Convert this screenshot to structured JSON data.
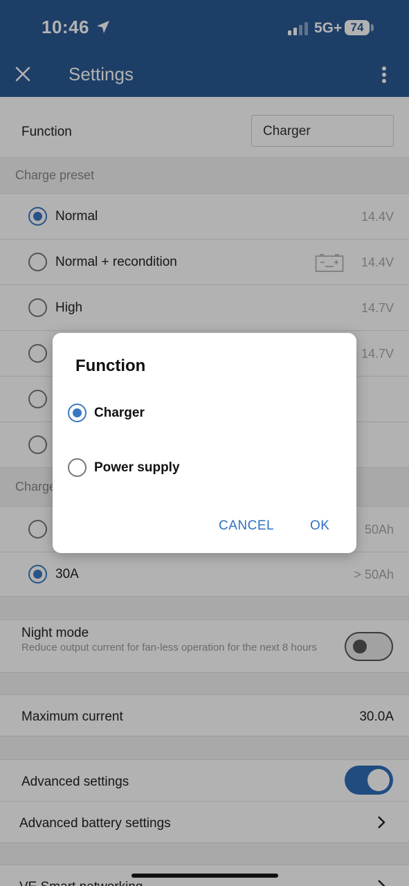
{
  "status_bar": {
    "time": "10:46",
    "network": "5G+",
    "battery": "74"
  },
  "app_bar": {
    "title": "Settings"
  },
  "function_row": {
    "label": "Function",
    "value": "Charger"
  },
  "charge_preset": {
    "heading": "Charge preset",
    "options": [
      {
        "label": "Normal",
        "voltage": "14.4V",
        "selected": true
      },
      {
        "label": "Normal + recondition",
        "voltage": "14.4V",
        "selected": false
      },
      {
        "label": "High",
        "voltage": "14.7V",
        "selected": false
      },
      {
        "label": "",
        "voltage": "14.7V",
        "selected": false
      },
      {
        "label": "",
        "voltage": "",
        "selected": false
      },
      {
        "label": "",
        "voltage": "",
        "selected": false
      }
    ]
  },
  "charge_current": {
    "heading": "Charge",
    "options": [
      {
        "label": "",
        "capacity": "50Ah",
        "selected": false
      },
      {
        "label": "30A",
        "capacity": "> 50Ah",
        "selected": true
      }
    ]
  },
  "night_mode": {
    "label": "Night mode",
    "description": "Reduce output current for fan-less operation for the next 8 hours",
    "enabled": false
  },
  "max_current": {
    "label": "Maximum current",
    "value": "30.0A"
  },
  "advanced_settings": {
    "label": "Advanced settings",
    "enabled": true
  },
  "advanced_battery": {
    "label": "Advanced battery settings"
  },
  "ve_smart": {
    "label": "VE.Smart networking"
  },
  "dialog": {
    "title": "Function",
    "options": [
      {
        "label": "Charger",
        "selected": true
      },
      {
        "label": "Power supply",
        "selected": false
      }
    ],
    "cancel_label": "CANCEL",
    "ok_label": "OK"
  },
  "colors": {
    "primary": "#2a5a94",
    "accent": "#3a78c2",
    "button_text": "#2f72bf"
  }
}
